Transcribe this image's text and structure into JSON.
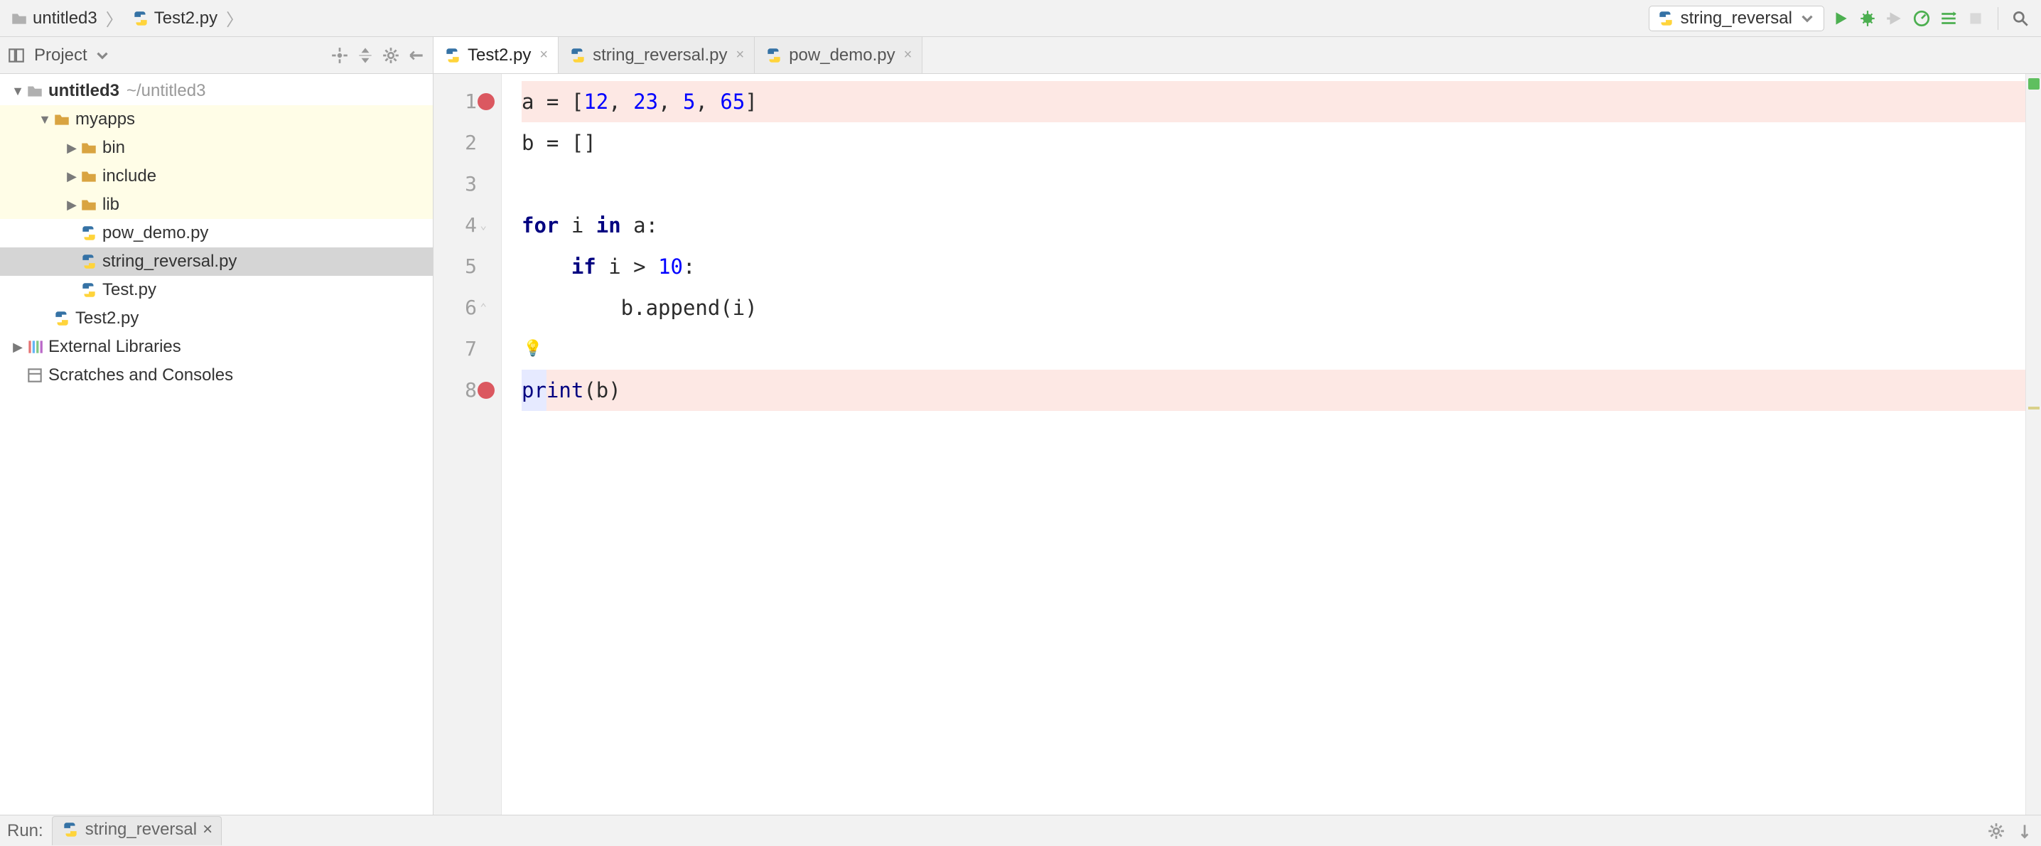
{
  "breadcrumb": [
    {
      "icon": "folder",
      "label": "untitled3"
    },
    {
      "icon": "pyfile",
      "label": "Test2.py"
    }
  ],
  "run_config": {
    "icon": "pyfile",
    "label": "string_reversal"
  },
  "project_pane": {
    "title": "Project",
    "tree": [
      {
        "depth": 0,
        "twisty": "▼",
        "icon": "folder",
        "label": "untitled3",
        "path": "~/untitled3",
        "bold": true
      },
      {
        "depth": 1,
        "twisty": "▼",
        "icon": "folder-open-y",
        "label": "myapps",
        "hl": true
      },
      {
        "depth": 2,
        "twisty": "▶",
        "icon": "folder-open-y",
        "label": "bin",
        "hl": true
      },
      {
        "depth": 2,
        "twisty": "▶",
        "icon": "folder-open-y",
        "label": "include",
        "hl": true
      },
      {
        "depth": 2,
        "twisty": "▶",
        "icon": "folder-open-y",
        "label": "lib",
        "hl": true
      },
      {
        "depth": 2,
        "twisty": "",
        "icon": "pyfile",
        "label": "pow_demo.py"
      },
      {
        "depth": 2,
        "twisty": "",
        "icon": "pyfile",
        "label": "string_reversal.py",
        "selected": true
      },
      {
        "depth": 2,
        "twisty": "",
        "icon": "pyfile",
        "label": "Test.py"
      },
      {
        "depth": 1,
        "twisty": "",
        "icon": "pyfile",
        "label": "Test2.py"
      },
      {
        "depth": 0,
        "twisty": "▶",
        "icon": "libs",
        "label": "External Libraries"
      },
      {
        "depth": 0,
        "twisty": "",
        "icon": "scratch",
        "label": "Scratches and Consoles"
      }
    ]
  },
  "editor_tabs": [
    {
      "icon": "pyfile",
      "label": "Test2.py",
      "active": true
    },
    {
      "icon": "pyfile",
      "label": "string_reversal.py"
    },
    {
      "icon": "pyfile",
      "label": "pow_demo.py"
    }
  ],
  "code": {
    "lines": [
      {
        "n": 1,
        "bp": true,
        "tokens": [
          [
            "",
            "a = ["
          ],
          [
            "num",
            "12"
          ],
          [
            "",
            ", "
          ],
          [
            "num",
            "23"
          ],
          [
            "",
            ", "
          ],
          [
            "num",
            "5"
          ],
          [
            "",
            ", "
          ],
          [
            "num",
            "65"
          ],
          [
            "",
            "]"
          ]
        ]
      },
      {
        "n": 2,
        "tokens": [
          [
            "",
            "b = []"
          ]
        ]
      },
      {
        "n": 3,
        "tokens": [
          [
            "",
            ""
          ]
        ]
      },
      {
        "n": 4,
        "fold": true,
        "tokens": [
          [
            "kw",
            "for"
          ],
          [
            "",
            " i "
          ],
          [
            "kw",
            "in"
          ],
          [
            "",
            " a:"
          ]
        ]
      },
      {
        "n": 5,
        "tokens": [
          [
            "",
            "    "
          ],
          [
            "kw",
            "if"
          ],
          [
            "",
            " i > "
          ],
          [
            "num",
            "10"
          ],
          [
            "",
            ":"
          ]
        ]
      },
      {
        "n": 6,
        "foldend": true,
        "tokens": [
          [
            "",
            "        b.append(i)"
          ]
        ]
      },
      {
        "n": 7,
        "bulb": true,
        "tokens": [
          [
            "",
            ""
          ]
        ]
      },
      {
        "n": 8,
        "bp": true,
        "caret": true,
        "tokens": [
          [
            "builtin",
            "print"
          ],
          [
            "",
            "(b)"
          ]
        ]
      }
    ]
  },
  "bottom": {
    "run_label": "Run:",
    "tab": {
      "icon": "pyfile",
      "label": "string_reversal"
    }
  }
}
